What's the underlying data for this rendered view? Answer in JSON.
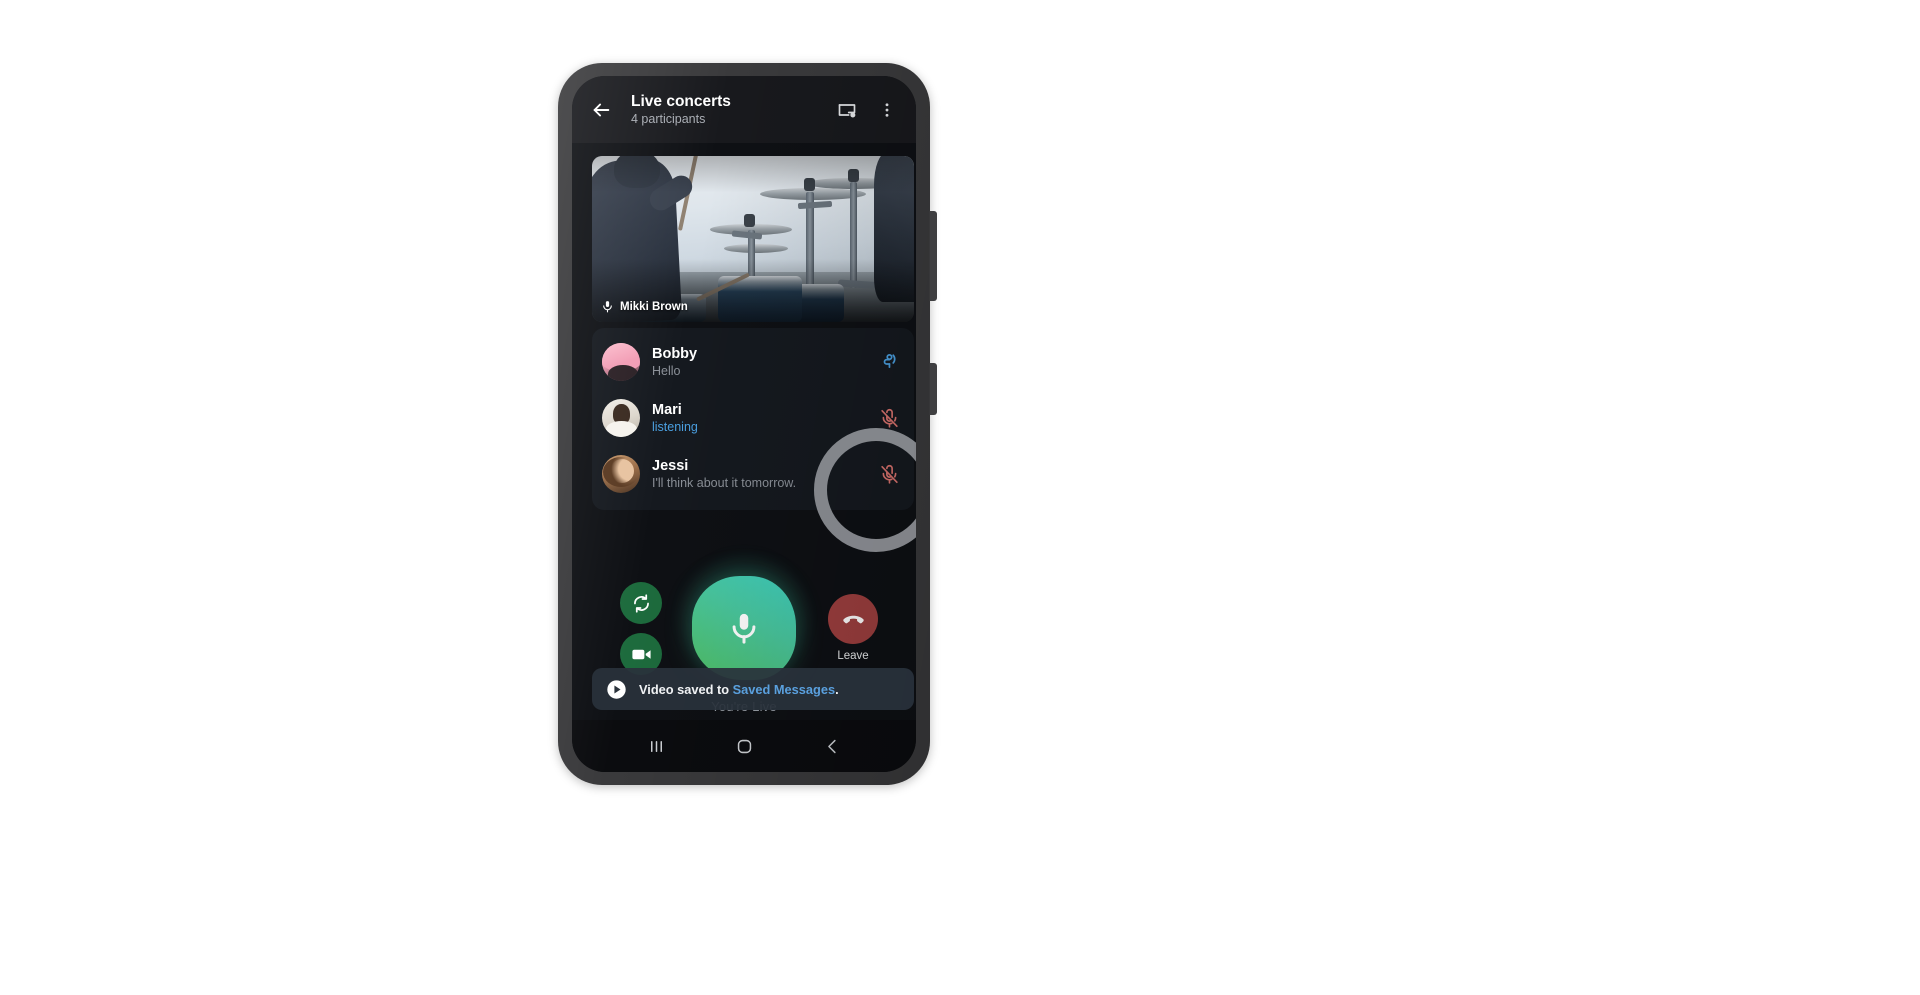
{
  "header": {
    "title": "Live concerts",
    "subtitle": "4 participants",
    "back_icon": "back-arrow-icon",
    "pip_icon": "picture-in-picture-icon",
    "menu_icon": "overflow-menu-icon"
  },
  "video": {
    "speaker_name": "Mikki Brown",
    "mic_icon": "microphone-icon"
  },
  "participants": [
    {
      "name": "Bobby",
      "status": "Hello",
      "status_kind": "plain",
      "action_icon": "raise-hand-icon",
      "action_color": "#4a9fe0"
    },
    {
      "name": "Mari",
      "status": "listening",
      "status_kind": "listening",
      "action_icon": "mic-muted-icon",
      "action_color": "#d9736e"
    },
    {
      "name": "Jessi",
      "status": "I'll think about it tomorrow.",
      "status_kind": "plain",
      "action_icon": "mic-muted-icon",
      "action_color": "#d9736e"
    }
  ],
  "controls": {
    "live_status": "You're Live",
    "mic_button_icon": "microphone-icon",
    "flip_camera_icon": "flip-camera-icon",
    "video_camera_icon": "video-camera-icon",
    "leave_label": "Leave",
    "leave_icon": "hangup-phone-icon"
  },
  "toast": {
    "icon": "play-circle-icon",
    "text_prefix": "Video saved to ",
    "link_text": "Saved Messages",
    "text_suffix": "."
  },
  "navbar": {
    "recents_icon": "recents-icon",
    "home_icon": "home-icon",
    "back_icon": "nav-back-icon"
  },
  "colors": {
    "accent_blue": "#4a9fe0",
    "mute_red": "#d9736e",
    "mic_green": "#49c79e",
    "leave_red": "#9e3f3f",
    "panel_bg": "#15191f",
    "screen_bg": "#0e1014"
  }
}
